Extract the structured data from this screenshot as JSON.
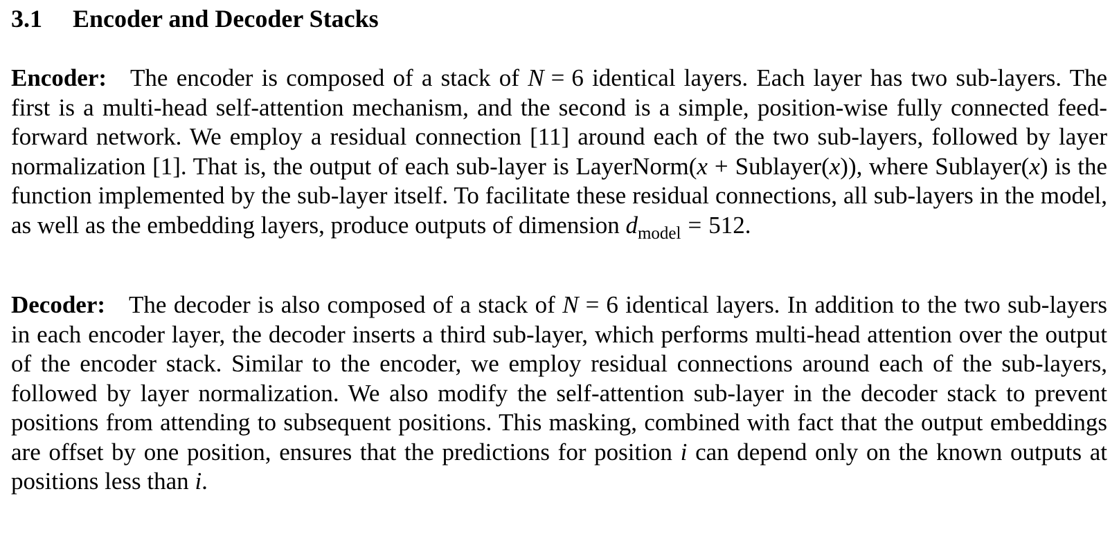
{
  "section": {
    "number": "3.1",
    "title": "Encoder and Decoder Stacks"
  },
  "encoder": {
    "label": "Encoder:",
    "t1": "The encoder is composed of a stack of",
    "N": "N",
    "eq": "=",
    "six": "6",
    "t2": "identical layers. Each layer has two sub-layers. The first is a multi-head self-attention mechanism, and the second is a simple, position-wise fully connected feed-forward network. We employ a residual connection [11] around each of the two sub-layers, followed by layer normalization [1]. That is, the output of each sub-layer is",
    "layernorm": "LayerNorm(",
    "x": "x",
    "plus": "+",
    "sublayer_open": "Sublayer(",
    "close_close": "))",
    "t3": ", where",
    "sublayer_open2": "Sublayer(",
    "close": ")",
    "t4": "is the function implemented by the sub-layer itself. To facilitate these residual connections, all sub-layers in the model, as well as the embedding layers, produce outputs of dimension",
    "d": "d",
    "d_sub": "model",
    "value_512": "512",
    "end": "."
  },
  "decoder": {
    "label": "Decoder:",
    "t1": "The decoder is also composed of a stack of",
    "N": "N",
    "eq": "=",
    "six": "6",
    "t2": "identical layers. In addition to the two sub-layers in each encoder layer, the decoder inserts a third sub-layer, which performs multi-head attention over the output of the encoder stack. Similar to the encoder, we employ residual connections around each of the sub-layers, followed by layer normalization. We also modify the self-attention sub-layer in the decoder stack to prevent positions from attending to subsequent positions. This masking, combined with fact that the output embeddings are offset by one position, ensures that the predictions for position",
    "i": "i",
    "t3": "can depend only on the known outputs at positions less than",
    "i2": "i",
    "end": "."
  }
}
